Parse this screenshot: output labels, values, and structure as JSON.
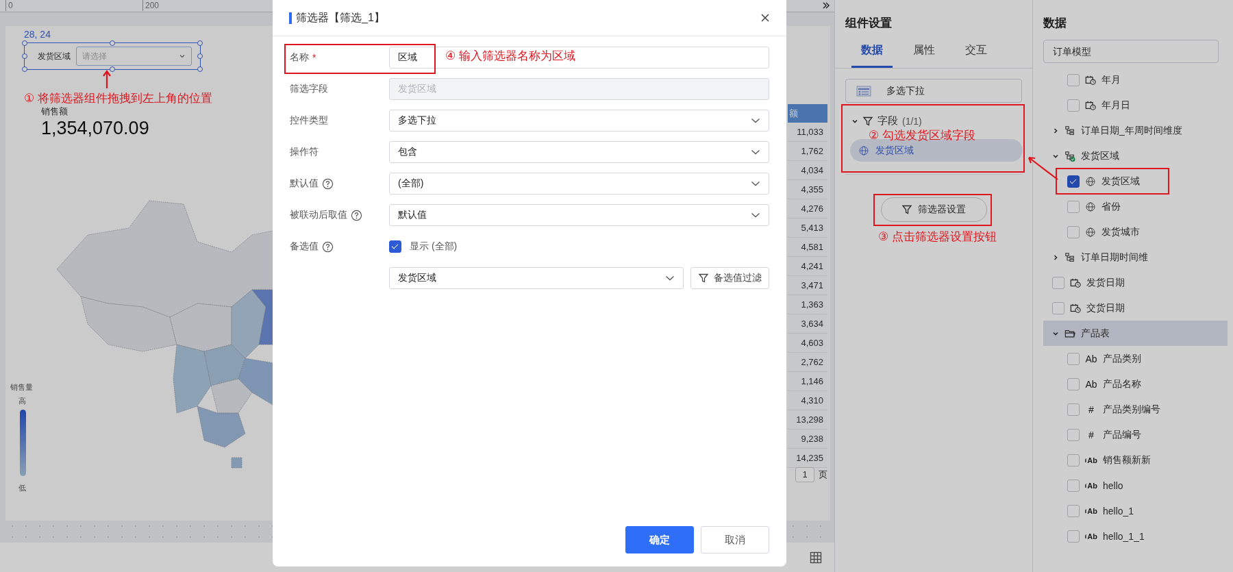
{
  "ruler": {
    "marks": [
      "0",
      "200"
    ]
  },
  "canvas": {
    "position_label": "28, 24",
    "filter_widget": {
      "label": "发货区域",
      "placeholder": "请选择"
    },
    "kpi": {
      "label": "销售额",
      "value": "1,354,070.09"
    },
    "legend": {
      "title": "销售量",
      "high": "高",
      "low": "低"
    },
    "table": {
      "header": "额",
      "values": [
        "11,033",
        "1,762",
        "4,034",
        "4,355",
        "4,276",
        "5,413",
        "4,581",
        "4,241",
        "3,471",
        "1,363",
        "3,634",
        "4,603",
        "2,762",
        "1,146",
        "4,310",
        "13,298",
        "9,238",
        "14,235"
      ],
      "page": "1",
      "page_unit": "页"
    },
    "note": "① 将筛选器组件拖拽到左上角的位置"
  },
  "dialog": {
    "title": "筛选器【筛选_1】",
    "required_mark": "*",
    "note": "④ 输入筛选器名称为区域",
    "fields": [
      {
        "label": "名称",
        "required": true,
        "help": false,
        "kind": "input",
        "value": "区域",
        "disabled": false
      },
      {
        "label": "筛选字段",
        "required": false,
        "help": false,
        "kind": "input",
        "value": "发货区域",
        "disabled": true
      },
      {
        "label": "控件类型",
        "required": false,
        "help": false,
        "kind": "select",
        "value": "多选下拉"
      },
      {
        "label": "操作符",
        "required": false,
        "help": false,
        "kind": "select",
        "value": "包含"
      },
      {
        "label": "默认值",
        "required": false,
        "help": true,
        "kind": "select",
        "value": "(全部)"
      },
      {
        "label": "被联动后取值",
        "required": false,
        "help": true,
        "kind": "select",
        "value": "默认值"
      },
      {
        "label": "备选值",
        "required": false,
        "help": true,
        "kind": "checkbox",
        "checked": true,
        "text": "显示 (全部)"
      },
      {
        "required": false,
        "help": false,
        "kind": "select-button",
        "value": "发货区域",
        "button": "备选值过滤"
      }
    ],
    "buttons": [
      {
        "label": "确定",
        "primary": true
      },
      {
        "label": "取消",
        "primary": false
      }
    ]
  },
  "settings": {
    "title": "组件设置",
    "tabs": [
      {
        "label": "数据",
        "selected": true
      },
      {
        "label": "属性",
        "selected": false
      },
      {
        "label": "交互",
        "selected": false
      }
    ],
    "widget_type": "多选下拉",
    "section": {
      "title": "字段",
      "count": "(1/1)",
      "expanded": true,
      "chip": "发货区域"
    },
    "field_note": "② 勾选发货区域字段",
    "button": "筛选器设置",
    "button_note": "③ 点击筛选器设置按钮"
  },
  "data": {
    "title": "数据",
    "model": "订单模型",
    "tree": [
      {
        "kind": "scrolled-parent",
        "children": [
          {
            "label": "年月",
            "kind": "date",
            "checked": false
          },
          {
            "label": "年月日",
            "kind": "date",
            "checked": false
          }
        ]
      },
      {
        "label": "订单日期_年周时间维度",
        "kind": "hierarchy",
        "expanded": false,
        "used": false,
        "selected": false
      },
      {
        "label": "发货区域",
        "kind": "hierarchy",
        "expanded": true,
        "used": true,
        "selected": false,
        "children": [
          {
            "label": "发货区域",
            "kind": "geo",
            "checked": true
          },
          {
            "label": "省份",
            "kind": "geo",
            "checked": false
          },
          {
            "label": "发货城市",
            "kind": "geo",
            "checked": false
          }
        ]
      },
      {
        "label": "订单日期时间维",
        "kind": "hierarchy",
        "expanded": false,
        "used": false,
        "selected": false
      },
      {
        "label": "发货日期",
        "kind": "datetime",
        "checked": false,
        "selected": false
      },
      {
        "label": "交货日期",
        "kind": "datetime",
        "checked": false,
        "selected": false
      },
      {
        "label": "产品表",
        "kind": "folder",
        "expanded": true,
        "selected": true,
        "children": [
          {
            "label": "产品类别",
            "kind": "text",
            "glyph": "Ab",
            "checked": false
          },
          {
            "label": "产品名称",
            "kind": "text",
            "glyph": "Ab",
            "checked": false
          },
          {
            "label": "产品类别编号",
            "kind": "number",
            "glyph": "#",
            "checked": false
          },
          {
            "label": "产品编号",
            "kind": "number",
            "glyph": "#",
            "checked": false
          },
          {
            "label": "销售额新新",
            "kind": "measure-text",
            "glyph": "Ab",
            "checked": false
          },
          {
            "label": "hello",
            "kind": "measure-text",
            "glyph": "Ab",
            "checked": false
          },
          {
            "label": "hello_1",
            "kind": "measure-text",
            "glyph": "Ab",
            "checked": false
          },
          {
            "label": "hello_1_1",
            "kind": "measure-text",
            "glyph": "Ab",
            "checked": false
          }
        ]
      }
    ]
  }
}
